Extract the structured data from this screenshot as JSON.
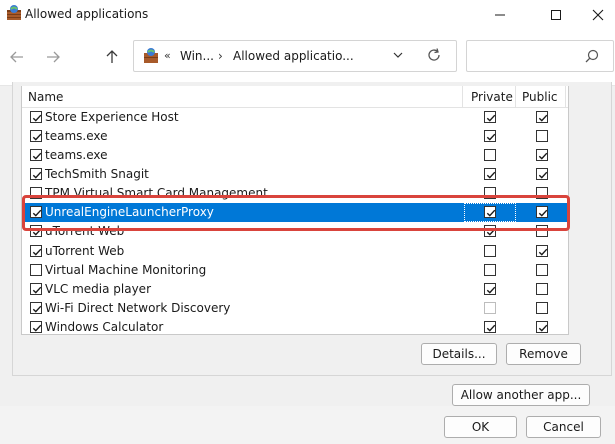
{
  "window": {
    "title": "Allowed applications",
    "controls": {
      "minimize": "minimize",
      "maximize": "maximize",
      "close": "close"
    }
  },
  "navigation": {
    "address_chevron": "«",
    "breadcrumb": [
      "Win...",
      "Allowed applicatio..."
    ],
    "separator": "›"
  },
  "list": {
    "headers": {
      "name": "Name",
      "private": "Private",
      "public": "Public"
    },
    "rows": [
      {
        "name": "Store Experience Host",
        "enabled": true,
        "private": true,
        "public": true,
        "selected": false
      },
      {
        "name": "teams.exe",
        "enabled": true,
        "private": true,
        "public": false,
        "selected": false
      },
      {
        "name": "teams.exe",
        "enabled": true,
        "private": false,
        "public": true,
        "selected": false
      },
      {
        "name": "TechSmith Snagit",
        "enabled": true,
        "private": true,
        "public": true,
        "selected": false
      },
      {
        "name": "TPM Virtual Smart Card Management",
        "enabled": false,
        "private": false,
        "public": false,
        "selected": false
      },
      {
        "name": "UnrealEngineLauncherProxy",
        "enabled": true,
        "private": true,
        "public": true,
        "selected": true
      },
      {
        "name": "uTorrent Web",
        "enabled": true,
        "private": true,
        "public": false,
        "selected": false
      },
      {
        "name": "uTorrent Web",
        "enabled": true,
        "private": false,
        "public": true,
        "selected": false
      },
      {
        "name": "Virtual Machine Monitoring",
        "enabled": false,
        "private": false,
        "public": false,
        "selected": false
      },
      {
        "name": "VLC media player",
        "enabled": true,
        "private": true,
        "public": false,
        "selected": false
      },
      {
        "name": "Wi-Fi Direct Network Discovery",
        "enabled": true,
        "private": false,
        "public": false,
        "selected": false,
        "private_disabled": true
      },
      {
        "name": "Windows Calculator",
        "enabled": true,
        "private": true,
        "public": true,
        "selected": false
      }
    ]
  },
  "buttons": {
    "details": "Details...",
    "remove": "Remove",
    "allow_another": "Allow another app...",
    "ok": "OK",
    "cancel": "Cancel"
  },
  "colors": {
    "selection": "#0078d7",
    "highlight_border": "#d9443c"
  }
}
